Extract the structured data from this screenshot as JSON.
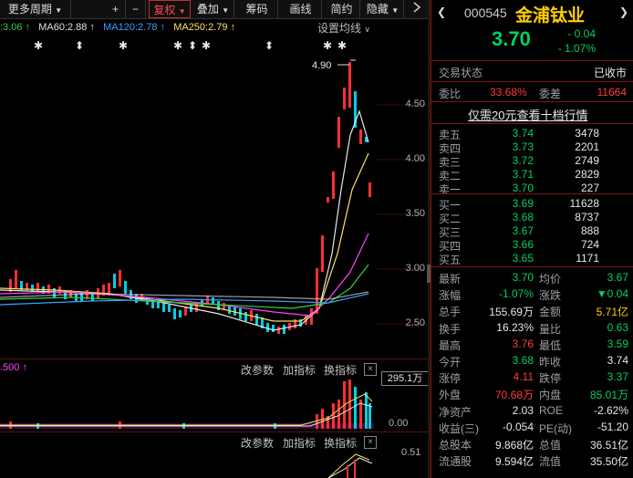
{
  "toolbar": {
    "period": "更多周期",
    "plus": "+",
    "minus": "−",
    "fuquan": "复权",
    "diejia": "叠加",
    "chouma": "筹码",
    "huaxian": "画线",
    "jianyue": "简约",
    "yincang": "隐藏"
  },
  "ma": {
    "ma_prev": ":3.06 ↑",
    "ma60": "MA60:2.88 ↑",
    "ma120": "MA120:2.78 ↑",
    "ma250": "MA250:2.79 ↑",
    "settings": "设置均线"
  },
  "price_axis": [
    "4.50",
    "4.00",
    "3.50",
    "3.00",
    "2.50"
  ],
  "high_marker": "4.90",
  "sub1": {
    "left_label": ".500 ↑",
    "params": "改参数",
    "add": "加指标",
    "change": "换指标",
    "close": "×",
    "volume_top": "295.1万",
    "volume_zero": "0.00"
  },
  "sub2": {
    "params": "改参数",
    "add": "加指标",
    "change": "换指标",
    "close": "×",
    "value": "0.51"
  },
  "stock": {
    "code": "000545",
    "name": "金浦钛业",
    "price": "3.70",
    "change": "- 0.04",
    "change_pct": "- 1.07%",
    "trade_status_label": "交易状态",
    "trade_status": "已收市",
    "weibi_label": "委比",
    "weibi": "33.68%",
    "weicha_label": "委差",
    "weicha": "11664",
    "promo": "仅需20元查看十档行情"
  },
  "asks": [
    {
      "label": "卖五",
      "price": "3.74",
      "vol": "3478"
    },
    {
      "label": "卖四",
      "price": "3.73",
      "vol": "2201"
    },
    {
      "label": "卖三",
      "price": "3.72",
      "vol": "2749"
    },
    {
      "label": "卖二",
      "price": "3.71",
      "vol": "2829"
    },
    {
      "label": "卖一",
      "price": "3.70",
      "vol": "227"
    }
  ],
  "bids": [
    {
      "label": "买一",
      "price": "3.69",
      "vol": "11628"
    },
    {
      "label": "买二",
      "price": "3.68",
      "vol": "8737"
    },
    {
      "label": "买三",
      "price": "3.67",
      "vol": "888"
    },
    {
      "label": "买四",
      "price": "3.66",
      "vol": "724"
    },
    {
      "label": "买五",
      "price": "3.65",
      "vol": "1171"
    }
  ],
  "stats": [
    {
      "l1": "最新",
      "v1": "3.70",
      "c1": "green",
      "l2": "均价",
      "v2": "3.67",
      "c2": "green"
    },
    {
      "l1": "涨幅",
      "v1": "-1.07%",
      "c1": "green",
      "l2": "涨跌",
      "v2": "▼0.04",
      "c2": "green"
    },
    {
      "l1": "总手",
      "v1": "155.69万",
      "c1": "white",
      "l2": "金额",
      "v2": "5.71亿",
      "c2": "yellow"
    },
    {
      "l1": "换手",
      "v1": "16.23%",
      "c1": "white",
      "l2": "量比",
      "v2": "0.63",
      "c2": "green"
    },
    {
      "l1": "最高",
      "v1": "3.76",
      "c1": "red",
      "l2": "最低",
      "v2": "3.59",
      "c2": "green"
    },
    {
      "l1": "今开",
      "v1": "3.68",
      "c1": "green",
      "l2": "昨收",
      "v2": "3.74",
      "c2": "white"
    },
    {
      "l1": "涨停",
      "v1": "4.11",
      "c1": "red",
      "l2": "跌停",
      "v2": "3.37",
      "c2": "green"
    },
    {
      "l1": "外盘",
      "v1": "70.68万",
      "c1": "red",
      "l2": "内盘",
      "v2": "85.01万",
      "c2": "green"
    },
    {
      "l1": "净资产",
      "v1": "2.03",
      "c1": "white",
      "l2": "ROE",
      "v2": "-2.62%",
      "c2": "white"
    },
    {
      "l1": "收益(三)",
      "v1": "-0.054",
      "c1": "white",
      "l2": "PE(动)",
      "v2": "-51.20",
      "c2": "white"
    },
    {
      "l1": "总股本",
      "v1": "9.868亿",
      "c1": "white",
      "l2": "总值",
      "v2": "36.51亿",
      "c2": "white"
    },
    {
      "l1": "流通股",
      "v1": "9.594亿",
      "c1": "white",
      "l2": "流值",
      "v2": "35.50亿",
      "c2": "white"
    }
  ]
}
